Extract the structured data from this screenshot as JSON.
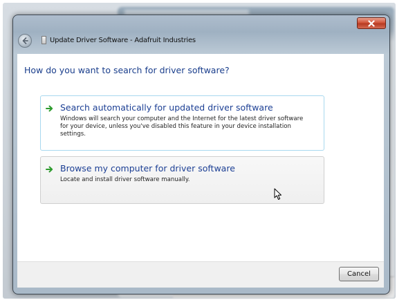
{
  "window": {
    "title": "Update Driver Software - Adafruit Industries"
  },
  "icons": {
    "back": "back-arrow-icon",
    "close": "close-icon",
    "option_arrow": "green-arrow-icon",
    "cursor": "mouse-pointer-icon"
  },
  "colors": {
    "heading": "#1a3e8c",
    "option_title": "#1c3f94",
    "option_arrow": "#2e9b2e",
    "close_button": "#c94a30",
    "selected_border": "#a8d8ef"
  },
  "main": {
    "heading": "How do you want to search for driver software?",
    "options": [
      {
        "title": "Search automatically for updated driver software",
        "description_lines": [
          "Windows will search your computer and the Internet for the latest driver software",
          "for your device, unless you've disabled this feature in your device installation",
          "settings."
        ]
      },
      {
        "title": "Browse my computer for driver software",
        "description_lines": [
          "Locate and install driver software manually."
        ]
      }
    ]
  },
  "footer": {
    "cancel_label": "Cancel"
  }
}
